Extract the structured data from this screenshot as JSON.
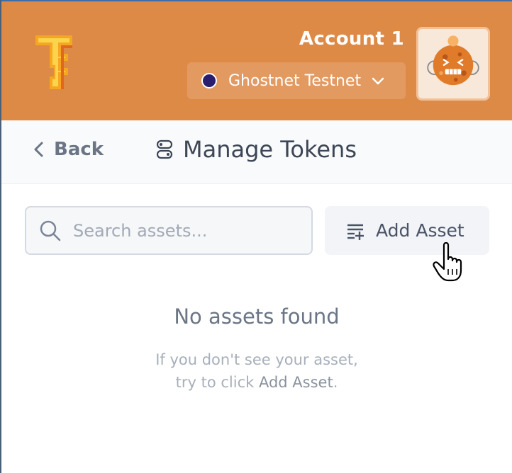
{
  "header": {
    "account_name": "Account 1",
    "network": {
      "label": "Ghostnet Testnet",
      "dot_color": "#2a1f6e"
    },
    "colors": {
      "background": "#de8a47"
    }
  },
  "titlebar": {
    "back_label": "Back",
    "title": "Manage Tokens"
  },
  "search": {
    "placeholder": "Search assets...",
    "value": ""
  },
  "add_asset": {
    "label": "Add Asset"
  },
  "empty_state": {
    "title": "No assets found",
    "line1": "If you don't see your asset,",
    "line2_prefix": "try to click ",
    "line2_link": "Add Asset",
    "line2_suffix": "."
  },
  "icons": [
    "logo-icon",
    "chevron-down-icon",
    "avatar-icon",
    "chevron-left-icon",
    "manage-tokens-icon",
    "search-icon",
    "add-list-icon",
    "hand-cursor-icon"
  ]
}
